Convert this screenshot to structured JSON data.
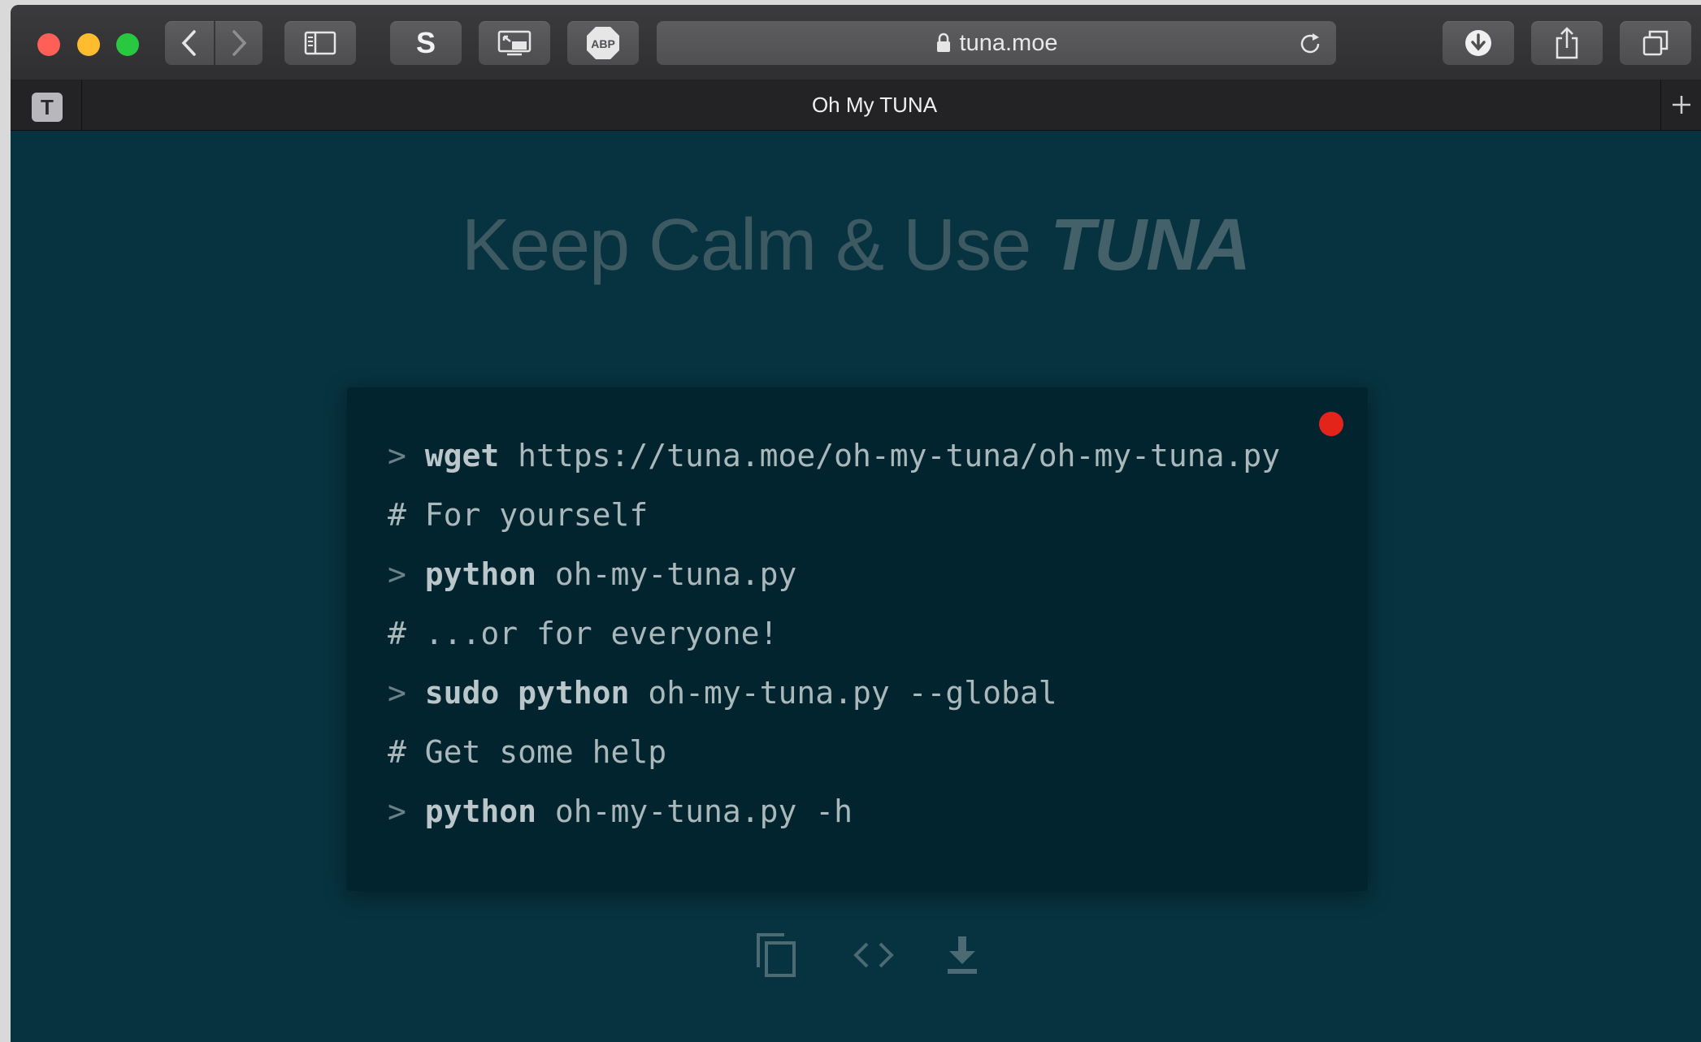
{
  "browser": {
    "url": "tuna.moe",
    "tab_favicon_letter": "T",
    "tab_title": "Oh My TUNA",
    "colors": {
      "close": "#fe5f57",
      "minimize": "#febc2e",
      "zoom": "#28c840"
    },
    "toolbar_icons": [
      "back-icon",
      "forward-icon",
      "sidebar-icon",
      "s-extension-icon",
      "picture-in-picture-icon",
      "adblock-icon",
      "lock-icon",
      "reload-icon",
      "download-icon",
      "share-icon",
      "tabs-overview-icon",
      "new-tab-icon"
    ],
    "extension_s_label": "S",
    "adblock_label": "ABP"
  },
  "page": {
    "hero_prefix": "Keep Calm & Use ",
    "hero_brand": "TUNA",
    "terminal_lines": [
      {
        "prompt": "> ",
        "command": "wget",
        "args": " https://tuna.moe/oh-my-tuna/oh-my-tuna.py"
      },
      {
        "comment": "# For yourself"
      },
      {
        "prompt": "> ",
        "command": "python",
        "args": " oh-my-tuna.py"
      },
      {
        "comment": "# ...or for everyone!"
      },
      {
        "prompt": "> ",
        "command": "sudo python",
        "args": " oh-my-tuna.py --global"
      },
      {
        "comment": "# Get some help"
      },
      {
        "prompt": "> ",
        "command": "python",
        "args": " oh-my-tuna.py -h"
      }
    ],
    "action_icons": [
      "copy-icon",
      "code-icon",
      "download-icon"
    ],
    "colors": {
      "background": "#07323f",
      "terminal": "#02242e",
      "record_dot": "#e3241b"
    }
  }
}
